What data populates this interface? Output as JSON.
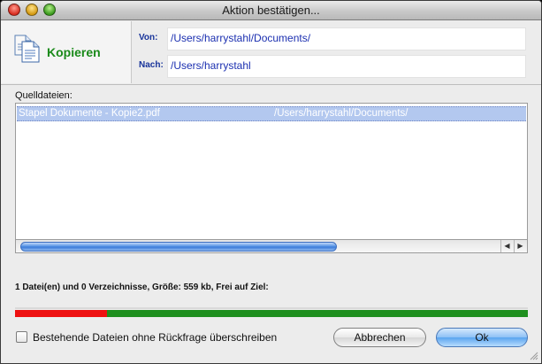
{
  "window": {
    "title": "Aktion bestätigen..."
  },
  "action": {
    "name": "Kopieren",
    "icon": "copy-documents-icon"
  },
  "paths": {
    "from_label": "Von:",
    "from_value": "/Users/harrystahl/Documents/",
    "to_label": "Nach:",
    "to_value": "/Users/harrystahl"
  },
  "source_files": {
    "label": "Quelldateien:",
    "rows": [
      {
        "name": "Stapel Dokumente - Kopie2.pdf",
        "path": "/Users/harrystahl/Documents/"
      }
    ]
  },
  "summary": "1 Datei(en) und 0 Verzeichnisse, Größe: 559 kb, Frei auf Ziel:",
  "disk_space": {
    "used_fraction": 0.18,
    "used_color": "#ee1111",
    "free_color": "#1e8f1e"
  },
  "overwrite": {
    "label": "Bestehende Dateien ohne Rückfrage überschreiben",
    "checked": false
  },
  "buttons": {
    "cancel": "Abbrechen",
    "ok": "Ok"
  },
  "colors": {
    "accent_green": "#1a8a1a",
    "path_blue": "#1b2fb0",
    "selection": "#b3c8ef"
  }
}
